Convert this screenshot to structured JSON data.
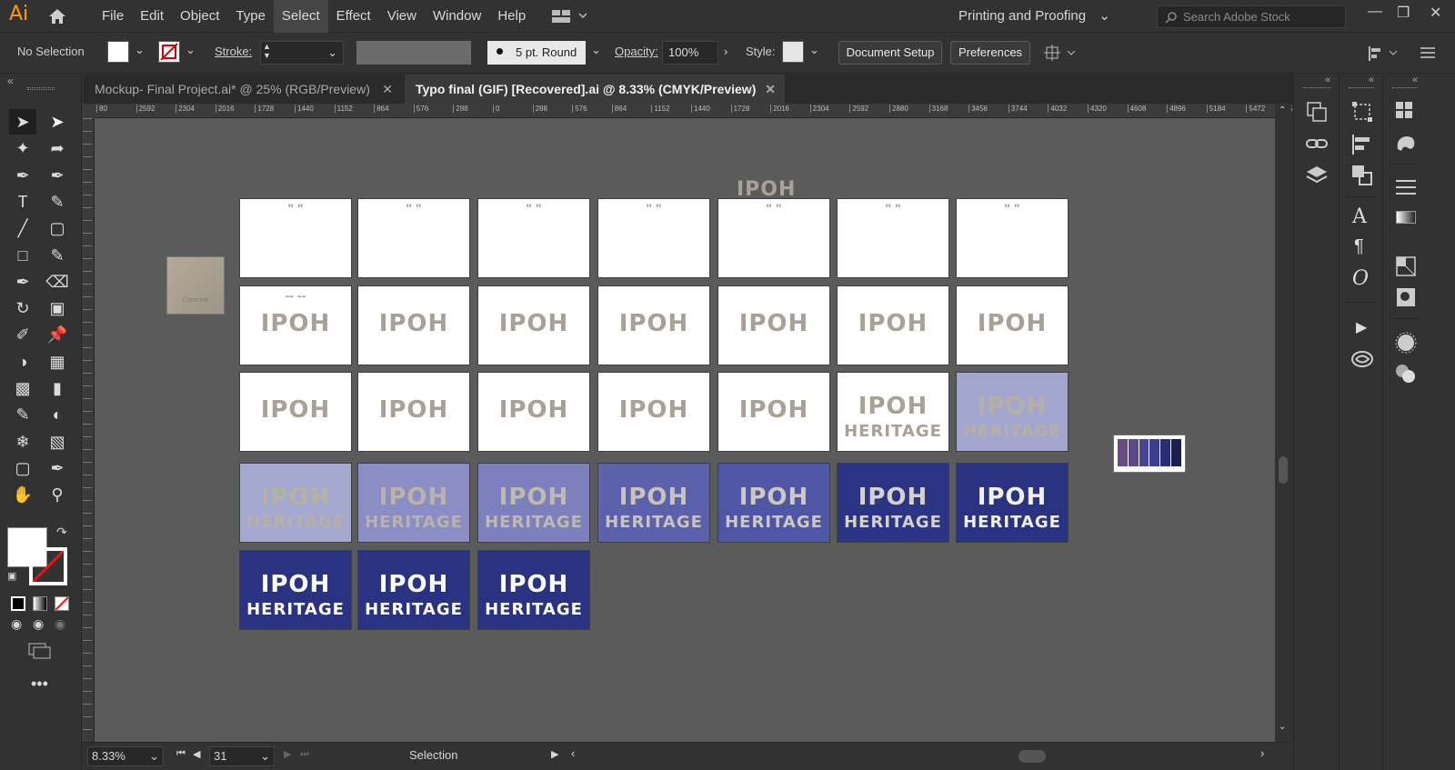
{
  "app": {
    "logo": "Ai"
  },
  "menu": [
    "File",
    "Edit",
    "Object",
    "Type",
    "Select",
    "Effect",
    "View",
    "Window",
    "Help"
  ],
  "menu_active": "Select",
  "workspace": "Printing and Proofing",
  "search": {
    "placeholder": "Search Adobe Stock"
  },
  "control": {
    "selection": "No Selection",
    "stroke_label": "Stroke:",
    "brush": "5 pt. Round",
    "opacity_label": "Opacity:",
    "opacity_value": "100%",
    "style_label": "Style:",
    "document_setup": "Document Setup",
    "preferences": "Preferences"
  },
  "tabs": [
    {
      "label": "Mockup- Final Project.ai* @ 25% (RGB/Preview)",
      "active": false
    },
    {
      "label": "Typo final (GIF) [Recovered].ai @ 8.33% (CMYK/Preview)",
      "active": true
    }
  ],
  "ruler_h": [
    "80",
    "2592",
    "2304",
    "2016",
    "1728",
    "1440",
    "1152",
    "864",
    "576",
    "288",
    "0",
    "288",
    "576",
    "864",
    "1152",
    "1440",
    "1728",
    "2016",
    "2304",
    "2592",
    "2880",
    "3168",
    "3456",
    "3744",
    "4032",
    "4320",
    "4608",
    "4896",
    "5184",
    "5472",
    "576"
  ],
  "status": {
    "zoom": "8.33%",
    "artboard": "31",
    "tool": "Selection"
  },
  "swatch_label": "Concrete",
  "artboard_text": {
    "line1": "IPOH",
    "line2": "HERITAGE"
  },
  "artboards": [
    {
      "bg": "#ffffff",
      "fg": "#a9a197",
      "l1": "",
      "l2": "",
      "ticks": "\"       \""
    },
    {
      "bg": "#ffffff",
      "fg": "#a9a197",
      "l1": "",
      "l2": "",
      "ticks": "\"       \""
    },
    {
      "bg": "#ffffff",
      "fg": "#a9a197",
      "l1": "",
      "l2": "",
      "ticks": "\"       \""
    },
    {
      "bg": "#ffffff",
      "fg": "#a9a197",
      "l1": "",
      "l2": "",
      "ticks": "\"       \""
    },
    {
      "bg": "#ffffff",
      "fg": "#a9a197",
      "l1": "",
      "l2": "",
      "ticks": "\"       \""
    },
    {
      "bg": "#ffffff",
      "fg": "#a9a197",
      "l1": "",
      "l2": "",
      "ticks": "\"       \""
    },
    {
      "bg": "#ffffff",
      "fg": "#a9a197",
      "l1": "",
      "l2": "",
      "ticks": "\"       \""
    },
    {
      "bg": "#ffffff",
      "fg": "#a9a197",
      "l1": "IPOH",
      "l2": "",
      "ticks": "--      --"
    },
    {
      "bg": "#ffffff",
      "fg": "#a9a197",
      "l1": "IPOH",
      "l2": "",
      "ticks": ""
    },
    {
      "bg": "#ffffff",
      "fg": "#a9a197",
      "l1": "IPOH",
      "l2": "",
      "ticks": ""
    },
    {
      "bg": "#ffffff",
      "fg": "#a9a197",
      "l1": "IPOH",
      "l2": "",
      "ticks": ""
    },
    {
      "bg": "#ffffff",
      "fg": "#a9a197",
      "l1": "IPOH",
      "l2": "",
      "ticks": ""
    },
    {
      "bg": "#ffffff",
      "fg": "#a9a197",
      "l1": "IPOH",
      "l2": "",
      "ticks": ""
    },
    {
      "bg": "#ffffff",
      "fg": "#a9a197",
      "l1": "IPOH",
      "l2": "",
      "ticks": ""
    },
    {
      "bg": "#ffffff",
      "fg": "#a9a197",
      "l1": "IPOH",
      "l2": "",
      "ticks": ""
    },
    {
      "bg": "#ffffff",
      "fg": "#a9a197",
      "l1": "IPOH",
      "l2": "",
      "ticks": ""
    },
    {
      "bg": "#ffffff",
      "fg": "#a9a197",
      "l1": "IPOH",
      "l2": "",
      "ticks": ""
    },
    {
      "bg": "#ffffff",
      "fg": "#a9a197",
      "l1": "IPOH",
      "l2": "",
      "ticks": ""
    },
    {
      "bg": "#ffffff",
      "fg": "#a9a197",
      "l1": "IPOH",
      "l2": "",
      "ticks": ""
    },
    {
      "bg": "#ffffff",
      "fg": "#a9a197",
      "l1": "IPOH",
      "l2": "HERITAGE",
      "ticks": ""
    },
    {
      "bg": "#a3a7cf",
      "fg": "#b8b09f",
      "l1": "IPOH",
      "l2": "HERITAGE",
      "ticks": ""
    },
    {
      "bg": "#a5a8cf",
      "fg": "#b9b1a0",
      "l1": "IPOH",
      "l2": "HERITAGE",
      "ticks": ""
    },
    {
      "bg": "#8a8ec4",
      "fg": "#bcb3a6",
      "l1": "IPOH",
      "l2": "HERITAGE",
      "ticks": ""
    },
    {
      "bg": "#7c81bd",
      "fg": "#c1b9ac",
      "l1": "IPOH",
      "l2": "HERITAGE",
      "ticks": ""
    },
    {
      "bg": "#5b61ab",
      "fg": "#cbc3b8",
      "l1": "IPOH",
      "l2": "HERITAGE",
      "ticks": ""
    },
    {
      "bg": "#4f56a5",
      "fg": "#cfc8bd",
      "l1": "IPOH",
      "l2": "HERITAGE",
      "ticks": ""
    },
    {
      "bg": "#2c3485",
      "fg": "#d7d2c9",
      "l1": "IPOH",
      "l2": "HERITAGE",
      "ticks": ""
    },
    {
      "bg": "#2a3282",
      "fg": "#f2f2f2",
      "l1": "IPOH",
      "l2": "HERITAGE",
      "ticks": ""
    },
    {
      "bg": "#2a3282",
      "fg": "#ffffff",
      "l1": "IPOH",
      "l2": "HERITAGE",
      "ticks": ""
    },
    {
      "bg": "#2a3282",
      "fg": "#ffffff",
      "l1": "IPOH",
      "l2": "HERITAGE",
      "ticks": ""
    },
    {
      "bg": "#2a3282",
      "fg": "#ffffff",
      "l1": "IPOH",
      "l2": "HERITAGE",
      "ticks": ""
    }
  ],
  "palette_colors": [
    "#6a4a86",
    "#5a4a8c",
    "#4a4592",
    "#3b3e8e",
    "#2a2d70",
    "#1b1d4c"
  ],
  "icons": {
    "home": "home-icon",
    "tools": [
      "selection-tool",
      "direct-selection-tool",
      "magic-wand-tool",
      "lasso-tool",
      "pen-tool",
      "curvature-tool",
      "type-tool",
      "pencil-tool",
      "line-tool",
      "rounded-rect-tool",
      "rectangle-tool",
      "paintbrush-tool",
      "blob-brush-tool",
      "eraser-tool",
      "rotate-tool",
      "scale-tool",
      "puppet-warp-tool",
      "pin-tool",
      "shape-builder-tool",
      "perspective-grid-tool",
      "mesh-tool",
      "gradient-tool",
      "eyedropper-tool",
      "blend-tool",
      "symbol-sprayer-tool",
      "graph-tool",
      "artboard-tool",
      "slice-tool",
      "hand-tool",
      "zoom-tool"
    ]
  }
}
